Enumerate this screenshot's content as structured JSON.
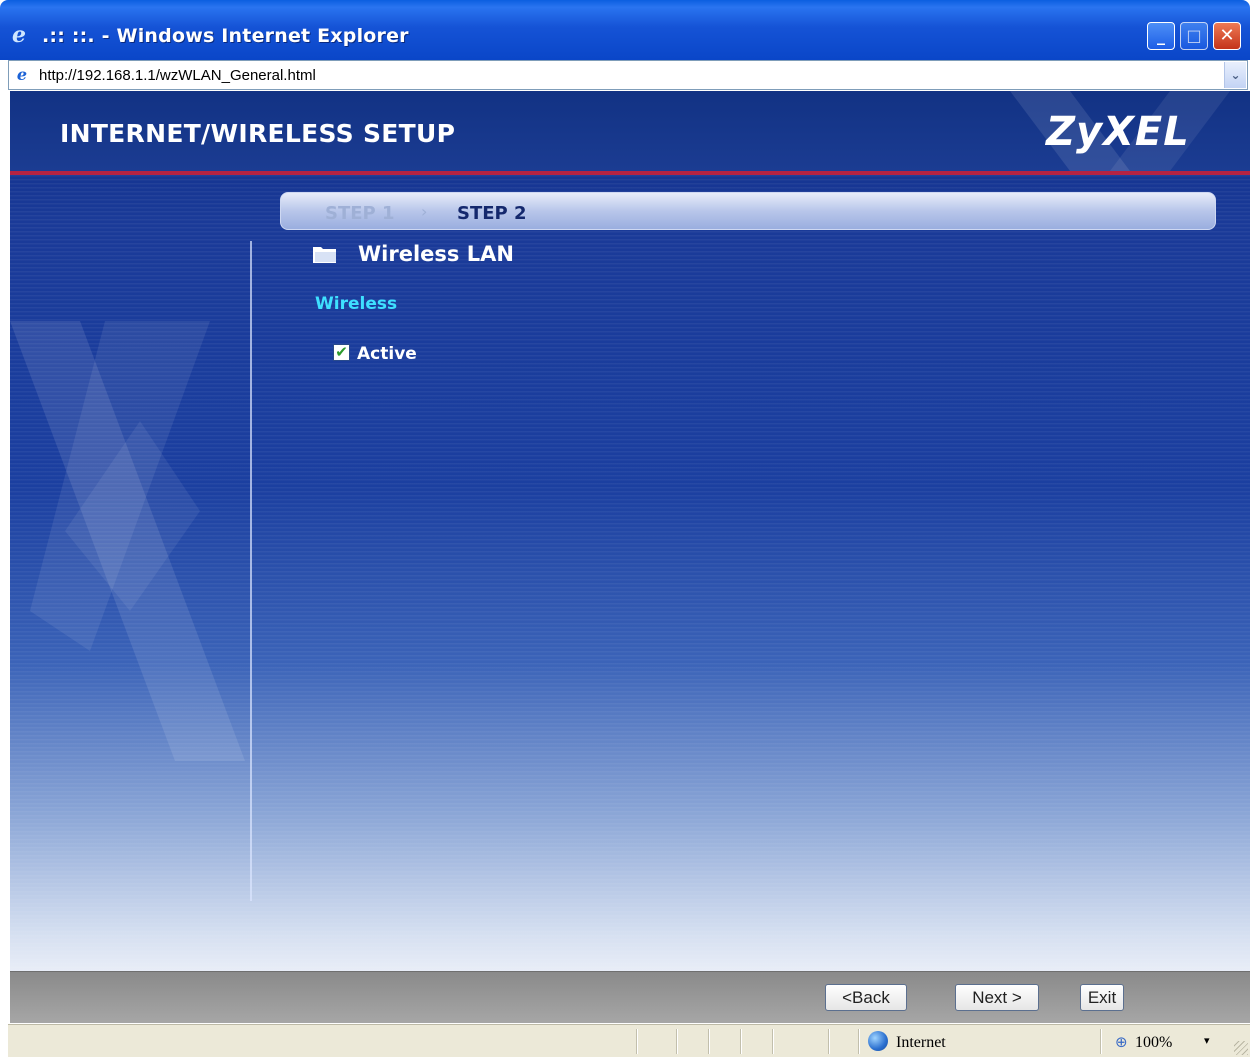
{
  "window": {
    "title": ".:: ::. - Windows Internet Explorer",
    "minimize_glyph": "_",
    "maximize_glyph": "□",
    "close_glyph": "✕"
  },
  "address": {
    "url": "http://192.168.1.1/wzWLAN_General.html",
    "dropdown_glyph": "⌄"
  },
  "page": {
    "title": "INTERNET/WIRELESS SETUP",
    "brand": "ZyXEL",
    "steps": {
      "step1": "STEP 1",
      "separator": "›",
      "step2": "STEP 2"
    },
    "section_title": "Wireless LAN",
    "subsection_label": "Wireless",
    "active_checkbox": {
      "label": "Active",
      "checked": true,
      "check_glyph": "✔"
    }
  },
  "buttons": {
    "back": "<Back",
    "next": "Next >",
    "exit": "Exit"
  },
  "statusbar": {
    "zone": "Internet",
    "zoom": "100%",
    "zoom_dropdown_glyph": "▾"
  },
  "colors": {
    "header_blue": "#123284",
    "accent_red": "#b42343",
    "subsection_cyan": "#3ee0ff",
    "title_bar_blue": "#0a46c8"
  }
}
